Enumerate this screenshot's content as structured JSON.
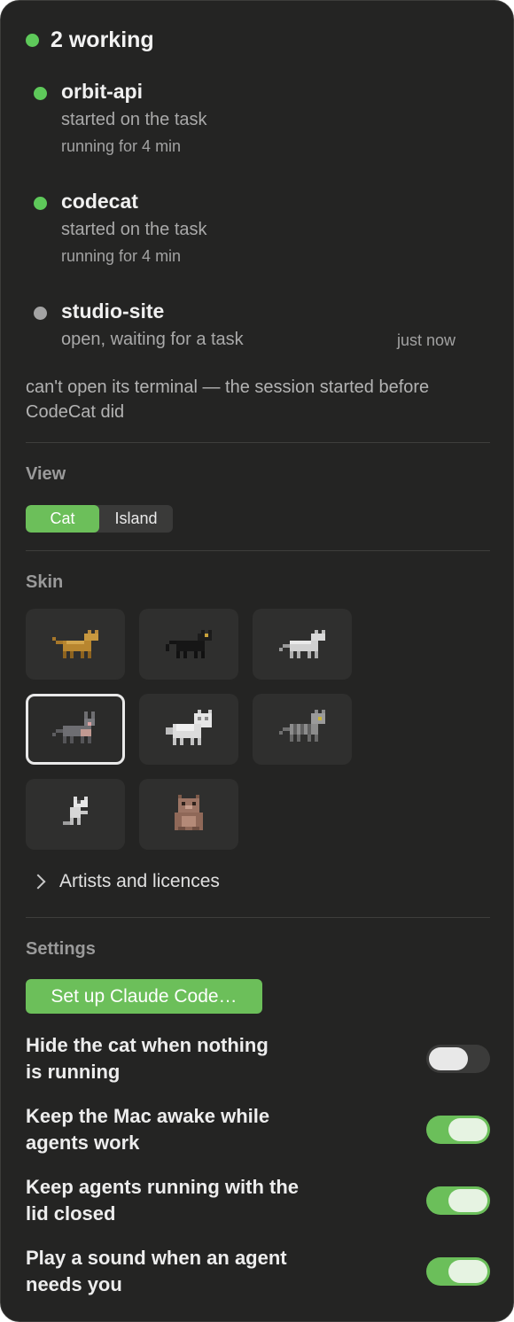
{
  "header": {
    "title": "2 working",
    "status_color": "#5ec95a"
  },
  "agents": [
    {
      "name": "orbit-api",
      "status": "started on the task",
      "detail": "running for 4 min",
      "state": "working",
      "color": "#5ec95a"
    },
    {
      "name": "codecat",
      "status": "started on the task",
      "detail": "running for 4 min",
      "state": "working",
      "color": "#5ec95a"
    },
    {
      "name": "studio-site",
      "status": "open, waiting for a task",
      "time": "just now",
      "state": "idle",
      "color": "#a3a3a3"
    }
  ],
  "note": "can't open its terminal — the session started before CodeCat did",
  "view": {
    "title": "View",
    "options": [
      "Cat",
      "Island"
    ],
    "selected": "Cat"
  },
  "skin": {
    "title": "Skin",
    "tiles": [
      {
        "icon": "tan-cat-icon"
      },
      {
        "icon": "black-cat-icon"
      },
      {
        "icon": "white-cat-icon"
      },
      {
        "icon": "gray-cat-icon",
        "selected": true
      },
      {
        "icon": "fluffy-white-cat-icon"
      },
      {
        "icon": "tabby-cat-icon"
      },
      {
        "icon": "small-white-cat-icon"
      },
      {
        "icon": "brown-sitting-cat-icon"
      }
    ],
    "artists_label": "Artists and licences"
  },
  "settings": {
    "title": "Settings",
    "setup_button": "Set up Claude Code…",
    "accent_color": "#6cbf5a",
    "toggles": [
      {
        "line1": "Hide the cat when nothing",
        "line2": "is running",
        "on": false
      },
      {
        "line1": "Keep the Mac awake while",
        "line2": "agents work",
        "on": true
      },
      {
        "line1": "Keep agents running with the",
        "line2": "lid closed",
        "on": true
      },
      {
        "line1": "Play a sound when an agent",
        "line2": "needs you",
        "on": true
      }
    ]
  }
}
